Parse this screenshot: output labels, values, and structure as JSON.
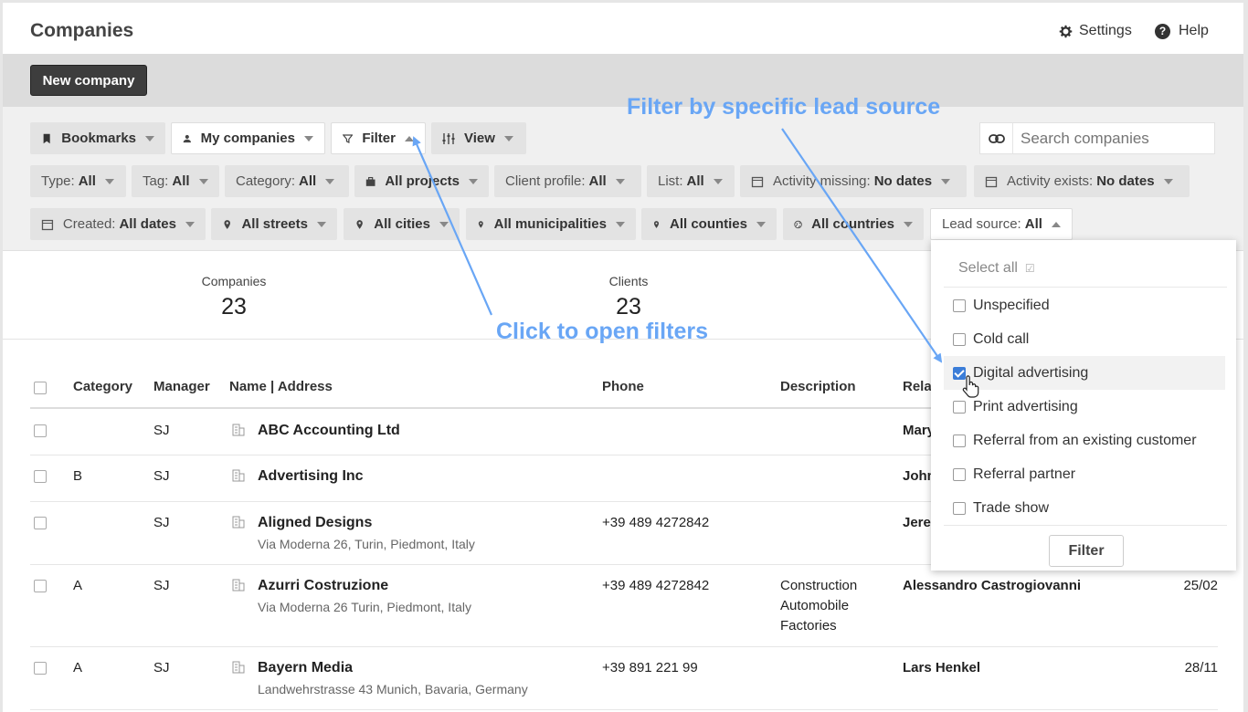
{
  "header": {
    "title": "Companies",
    "settings_label": "Settings",
    "help_label": "Help"
  },
  "actions": {
    "new_company_label": "New company"
  },
  "toolbar": {
    "bookmarks": "Bookmarks",
    "my_companies": "My companies",
    "filter": "Filter",
    "view": "View",
    "search_placeholder": "Search companies"
  },
  "filters": {
    "type": {
      "label": "Type:",
      "value": "All"
    },
    "tag": {
      "label": "Tag:",
      "value": "All"
    },
    "category": {
      "label": "Category:",
      "value": "All"
    },
    "projects": {
      "value": "All projects"
    },
    "client_profile": {
      "label": "Client profile:",
      "value": "All"
    },
    "list": {
      "label": "List:",
      "value": "All"
    },
    "activity_missing": {
      "label": "Activity missing:",
      "value": "No dates"
    },
    "activity_exists": {
      "label": "Activity exists:",
      "value": "No dates"
    },
    "created": {
      "label": "Created:",
      "value": "All dates"
    },
    "streets": {
      "value": "All streets"
    },
    "cities": {
      "value": "All cities"
    },
    "municipalities": {
      "value": "All municipalities"
    },
    "counties": {
      "value": "All counties"
    },
    "countries": {
      "value": "All countries"
    },
    "lead_source": {
      "label": "Lead source:",
      "value": "All"
    }
  },
  "stats": {
    "companies": {
      "label": "Companies",
      "value": "23"
    },
    "clients": {
      "label": "Clients",
      "value": "23"
    }
  },
  "table": {
    "headers": {
      "category": "Category",
      "manager": "Manager",
      "name": "Name | Address",
      "phone": "Phone",
      "description": "Description",
      "related": "Rela"
    },
    "rows": [
      {
        "category": "",
        "manager": "SJ",
        "name": "ABC Accounting Ltd",
        "address": "",
        "phone": "",
        "description": [
          "",
          "",
          ""
        ],
        "contact": "Mary",
        "date": ""
      },
      {
        "category": "B",
        "manager": "SJ",
        "name": "Advertising Inc",
        "address": "",
        "phone": "",
        "description": [
          "",
          "",
          ""
        ],
        "contact": "John",
        "date": ""
      },
      {
        "category": "",
        "manager": "SJ",
        "name": "Aligned Designs",
        "address": "Via Moderna 26, Turin, Piedmont, Italy",
        "phone": "+39 489 4272842",
        "description": [
          "",
          "",
          ""
        ],
        "contact": "Jere",
        "date": ""
      },
      {
        "category": "A",
        "manager": "SJ",
        "name": "Azurri Costruzione",
        "address": "Via Moderna 26 Turin, Piedmont, Italy",
        "phone": "+39 489 4272842",
        "description": [
          "Construction",
          "Automobile",
          "Factories"
        ],
        "contact": "Alessandro Castrogiovanni",
        "date": "25/02"
      },
      {
        "category": "A",
        "manager": "SJ",
        "name": "Bayern Media",
        "address": "Landwehrstrasse 43 Munich, Bavaria, Germany",
        "phone": "+39 891 221 99",
        "description": [
          "",
          "",
          ""
        ],
        "contact": "Lars Henkel",
        "date": "28/11"
      }
    ]
  },
  "lead_source_dropdown": {
    "select_all": "Select all",
    "options": [
      {
        "label": "Unspecified",
        "checked": false
      },
      {
        "label": "Cold call",
        "checked": false
      },
      {
        "label": "Digital advertising",
        "checked": true
      },
      {
        "label": "Print advertising",
        "checked": false
      },
      {
        "label": "Referral from an existing customer",
        "checked": false
      },
      {
        "label": "Referral partner",
        "checked": false
      },
      {
        "label": "Trade show",
        "checked": false
      }
    ],
    "filter_button": "Filter"
  },
  "annotations": {
    "lead_source_note": "Filter by specific lead source",
    "open_filters_note": "Click to open filters",
    "color": "#69a6f5"
  }
}
